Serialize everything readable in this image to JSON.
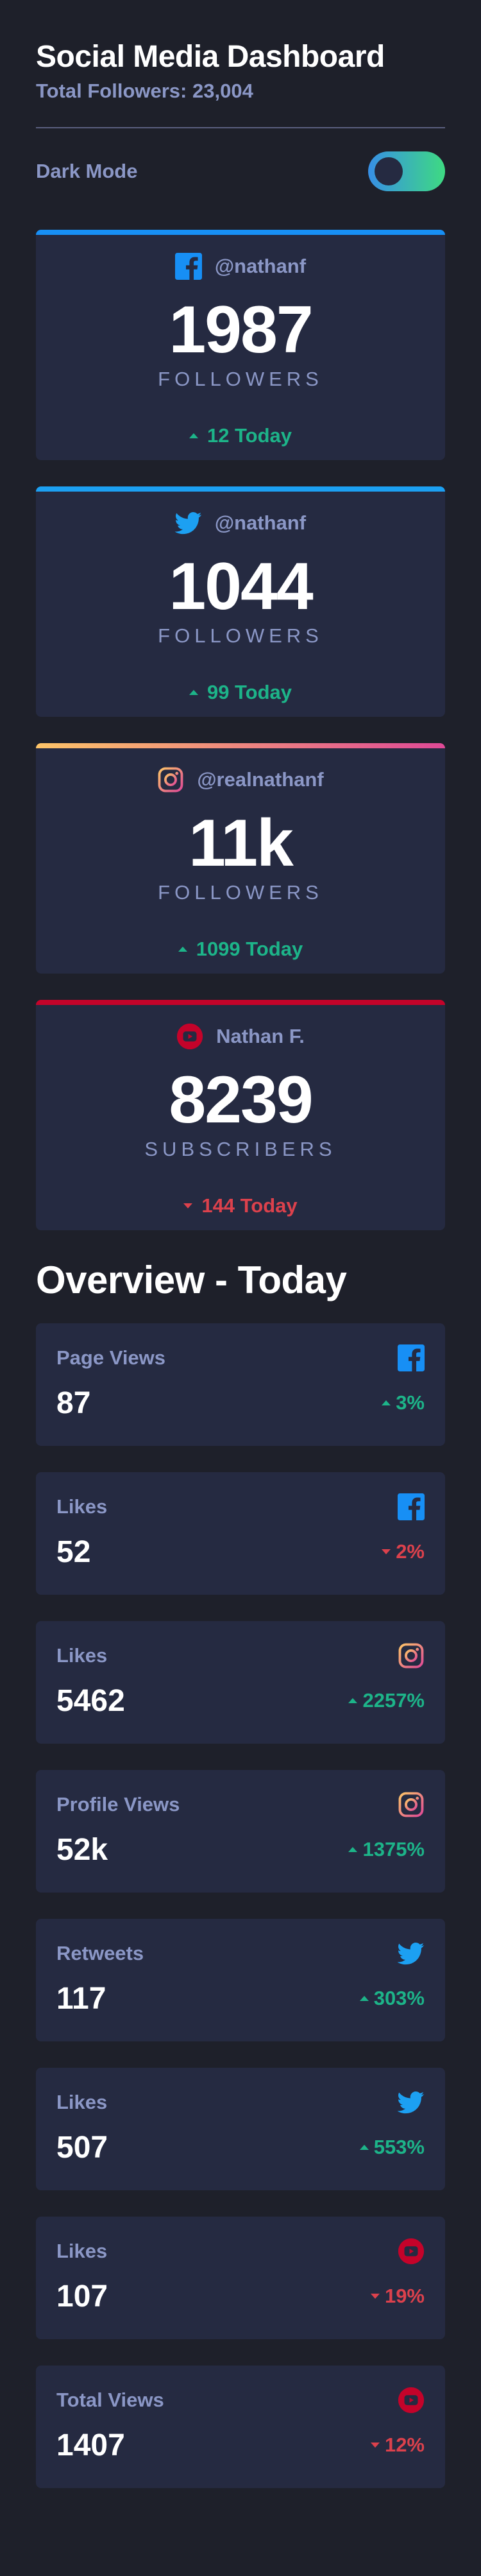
{
  "header": {
    "title": "Social Media Dashboard",
    "total_followers": "Total Followers: 23,004"
  },
  "dark_mode": {
    "label": "Dark Mode",
    "enabled": true
  },
  "colors": {
    "facebook": "#178ff5",
    "twitter": "#1ca0f2",
    "instagram_gradient": [
      "#fdc468",
      "#df4996"
    ],
    "youtube": "#c4032a",
    "up": "#1db489",
    "down": "#dc414c",
    "toggle_gradient": [
      "#378fe6",
      "#3eda82"
    ]
  },
  "cards": [
    {
      "platform": "facebook",
      "icon": "facebook-icon",
      "handle": "@nathanf",
      "count": "1987",
      "label": "FOLLOWERS",
      "trend": "up",
      "today": "12 Today"
    },
    {
      "platform": "twitter",
      "icon": "twitter-icon",
      "handle": "@nathanf",
      "count": "1044",
      "label": "FOLLOWERS",
      "trend": "up",
      "today": "99 Today"
    },
    {
      "platform": "instagram",
      "icon": "instagram-icon",
      "handle": "@realnathanf",
      "count": "11k",
      "label": "FOLLOWERS",
      "trend": "up",
      "today": "1099 Today"
    },
    {
      "platform": "youtube",
      "icon": "youtube-icon",
      "handle": "Nathan F.",
      "count": "8239",
      "label": "SUBSCRIBERS",
      "trend": "down",
      "today": "144 Today"
    }
  ],
  "overview": {
    "title": "Overview - Today",
    "items": [
      {
        "label": "Page Views",
        "platform": "facebook",
        "icon": "facebook-icon",
        "value": "87",
        "trend": "up",
        "percent": "3%"
      },
      {
        "label": "Likes",
        "platform": "facebook",
        "icon": "facebook-icon",
        "value": "52",
        "trend": "down",
        "percent": "2%"
      },
      {
        "label": "Likes",
        "platform": "instagram",
        "icon": "instagram-icon",
        "value": "5462",
        "trend": "up",
        "percent": "2257%"
      },
      {
        "label": "Profile Views",
        "platform": "instagram",
        "icon": "instagram-icon",
        "value": "52k",
        "trend": "up",
        "percent": "1375%"
      },
      {
        "label": "Retweets",
        "platform": "twitter",
        "icon": "twitter-icon",
        "value": "117",
        "trend": "up",
        "percent": "303%"
      },
      {
        "label": "Likes",
        "platform": "twitter",
        "icon": "twitter-icon",
        "value": "507",
        "trend": "up",
        "percent": "553%"
      },
      {
        "label": "Likes",
        "platform": "youtube",
        "icon": "youtube-icon",
        "value": "107",
        "trend": "down",
        "percent": "19%"
      },
      {
        "label": "Total Views",
        "platform": "youtube",
        "icon": "youtube-icon",
        "value": "1407",
        "trend": "down",
        "percent": "12%"
      }
    ]
  }
}
